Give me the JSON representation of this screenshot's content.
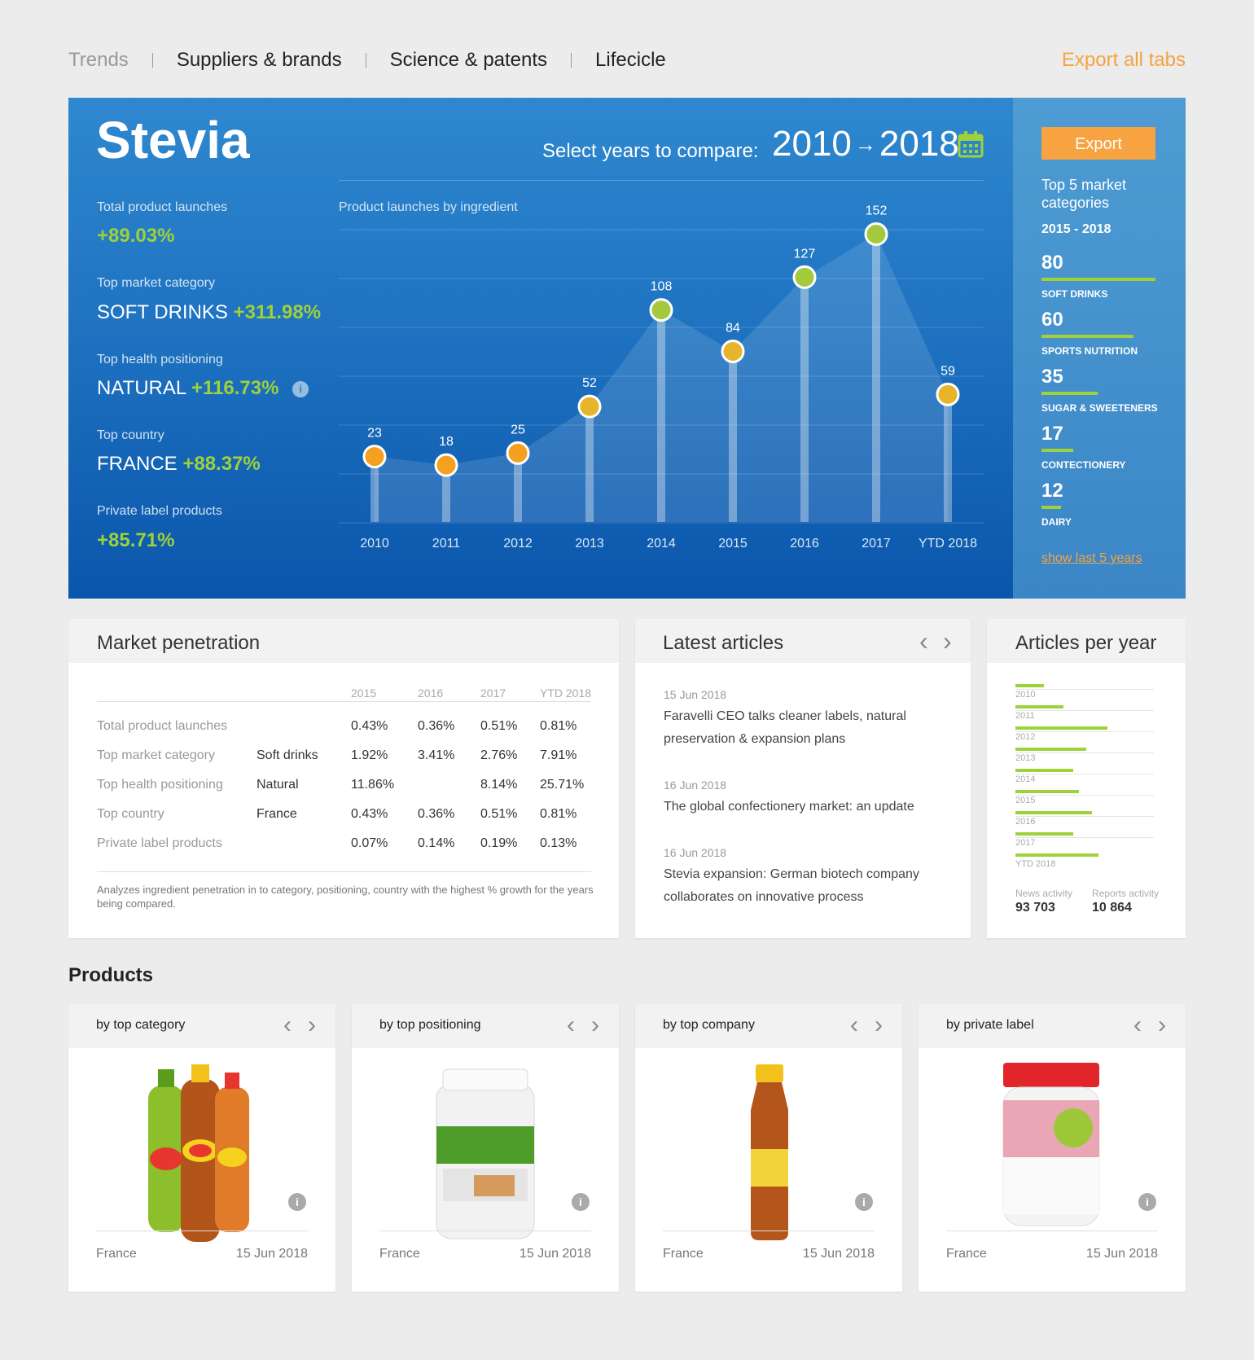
{
  "nav": {
    "tabs": [
      "Trends",
      "Suppliers & brands",
      "Science & patents",
      "Lifecicle"
    ],
    "export_all": "Export all tabs"
  },
  "hero": {
    "title": "Stevia",
    "compare_label": "Select years to compare:",
    "year_from": "2010",
    "year_to": "2018",
    "arrow": "→",
    "kpis": {
      "total_launches": {
        "label": "Total product launches",
        "value": "+89.03%"
      },
      "top_category": {
        "label": "Top market category",
        "name": "SOFT DRINKS",
        "value": "+311.98%"
      },
      "top_health": {
        "label": "Top health positioning",
        "name": "NATURAL",
        "value": "+116.73%"
      },
      "top_country": {
        "label": "Top country",
        "name": "FRANCE",
        "value": "+88.37%"
      },
      "private_label": {
        "label": "Private label products",
        "value": "+85.71%"
      }
    },
    "info_glyph": "i"
  },
  "chart_data": {
    "type": "line",
    "title": "Product launches by ingredient",
    "categories": [
      "2010",
      "2011",
      "2012",
      "2013",
      "2014",
      "2015",
      "2016",
      "2017",
      "YTD 2018"
    ],
    "values": [
      23,
      18,
      25,
      52,
      108,
      84,
      127,
      152,
      59
    ],
    "ylim": [
      -15,
      165
    ],
    "grid": true,
    "point_colors": {
      "low": "#f5a01e",
      "mid": "#e7b52c",
      "high": "#a4c93c"
    }
  },
  "side": {
    "export_label": "Export",
    "title": "Top 5 market categories",
    "range": "2015 - 2018",
    "categories": [
      {
        "value": "80",
        "name": "SOFT DRINKS",
        "share": 1.0
      },
      {
        "value": "60",
        "name": "SPORTS NUTRITION",
        "share": 0.81
      },
      {
        "value": "35",
        "name": "SUGAR & SWEETENERS",
        "share": 0.49
      },
      {
        "value": "17",
        "name": "CONTECTIONERY",
        "share": 0.28
      },
      {
        "value": "12",
        "name": "DAIRY",
        "share": 0.17
      }
    ],
    "show_last": "show last 5 years"
  },
  "market_penetration": {
    "title": "Market penetration",
    "columns": [
      "2015",
      "2016",
      "2017",
      "YTD 2018"
    ],
    "rows": [
      {
        "label": "Total product launches",
        "cat": "",
        "values": [
          "0.43%",
          "0.36%",
          "0.51%",
          "0.81%"
        ]
      },
      {
        "label": "Top market category",
        "cat": "Soft drinks",
        "values": [
          "1.92%",
          "3.41%",
          "2.76%",
          "7.91%"
        ]
      },
      {
        "label": "Top health positioning",
        "cat": "Natural",
        "values": [
          "11.86%",
          "",
          "8.14%",
          "25.71%"
        ]
      },
      {
        "label": "Top country",
        "cat": "France",
        "values": [
          "0.43%",
          "0.36%",
          "0.51%",
          "0.81%"
        ]
      },
      {
        "label": "Private label products",
        "cat": "",
        "values": [
          "0.07%",
          "0.14%",
          "0.19%",
          "0.13%"
        ]
      }
    ],
    "note": "Analyzes ingredient penetration in to category,  positioning, country with the highest % growth for the years being compared."
  },
  "articles": {
    "title": "Latest articles",
    "prev": "‹",
    "next": "›",
    "items": [
      {
        "date": "15 Jun 2018",
        "text": "Faravelli CEO talks cleaner labels, natural preservation & expansion plans"
      },
      {
        "date": "16 Jun 2018",
        "text": "The global confectionery market: an update"
      },
      {
        "date": "16 Jun 2018",
        "text": "Stevia expansion: German biotech company collaborates on innovative process"
      }
    ]
  },
  "articles_per_year": {
    "title": "Articles per year",
    "years": [
      {
        "year": "2010",
        "share": 0.25
      },
      {
        "year": "2011",
        "share": 0.42
      },
      {
        "year": "2012",
        "share": 0.81
      },
      {
        "year": "2013",
        "share": 0.62
      },
      {
        "year": "2014",
        "share": 0.51
      },
      {
        "year": "2015",
        "share": 0.56
      },
      {
        "year": "2016",
        "share": 0.67
      },
      {
        "year": "2017",
        "share": 0.51
      },
      {
        "year": "YTD 2018",
        "share": 0.73
      }
    ],
    "news_label": "News activity",
    "news_value": "93 703",
    "reports_label": "Reports activity",
    "reports_value": "10 864"
  },
  "products": {
    "title": "Products",
    "cards": [
      {
        "title": "by top category",
        "country": "France",
        "date": "15 Jun 2018",
        "image": "lipton-ice-tea-bottles"
      },
      {
        "title": "by top positioning",
        "country": "France",
        "date": "15 Jun 2018",
        "image": "protein-tub"
      },
      {
        "title": "by top company",
        "country": "France",
        "date": "15 Jun 2018",
        "image": "fuze-tea-bottle"
      },
      {
        "title": "by private label",
        "country": "France",
        "date": "15 Jun 2018",
        "image": "stevia-jar"
      }
    ]
  },
  "colors": {
    "accent_orange": "#f7a341",
    "accent_green": "#9ed13a",
    "hero_blue": "#1f73c1"
  }
}
